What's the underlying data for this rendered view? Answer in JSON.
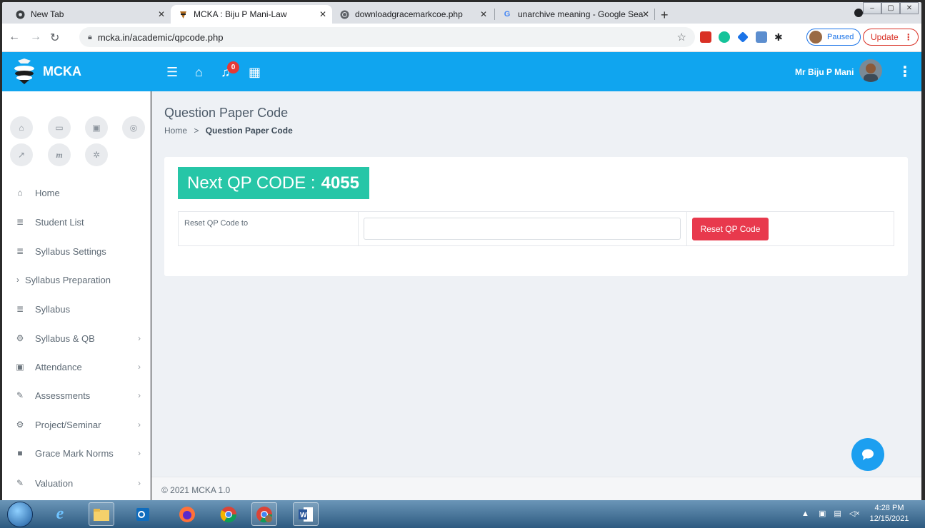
{
  "browser": {
    "tabs": [
      {
        "title": "New Tab",
        "icon": "chrome-newtab-icon"
      },
      {
        "title": "MCKA : Biju P Mani-Law",
        "icon": "mcka-logo-icon"
      },
      {
        "title": "downloadgracemarkcoe.php",
        "icon": "globe-icon"
      },
      {
        "title": "unarchive meaning - Google Sea",
        "icon": "google-icon"
      }
    ],
    "url": "mcka.in/academic/qpcode.php",
    "paused_label": "Paused",
    "update_label": "Update"
  },
  "app": {
    "brand": "MCKA",
    "notification_count": "0",
    "user_name": "Mr Biju P Mani",
    "header_color": "#10a5ef"
  },
  "sidebar": {
    "items": [
      {
        "label": "Home",
        "icon": "home-icon"
      },
      {
        "label": "Student List",
        "icon": "list-icon"
      },
      {
        "label": "Syllabus Settings",
        "icon": "list-icon"
      },
      {
        "label": "Syllabus Preparation",
        "icon": "chevron-right-icon"
      },
      {
        "label": "Syllabus",
        "icon": "list-icon"
      },
      {
        "label": "Syllabus & QB",
        "icon": "gears-icon"
      },
      {
        "label": "Attendance",
        "icon": "calendar-check-icon"
      },
      {
        "label": "Assessments",
        "icon": "pencil-icon"
      },
      {
        "label": "Project/Seminar",
        "icon": "gears-icon"
      },
      {
        "label": "Grace Mark Norms",
        "icon": "book-icon"
      },
      {
        "label": "Valuation",
        "icon": "pencil-icon"
      }
    ]
  },
  "page": {
    "title": "Question Paper Code",
    "breadcrumb_home": "Home",
    "breadcrumb_sep": ">",
    "breadcrumb_current": "Question Paper Code",
    "next_qp_label": "Next QP CODE :",
    "next_qp_value": "4055",
    "reset_label": "Reset QP Code to",
    "reset_input_value": "",
    "reset_button": "Reset QP Code",
    "accent_green": "#26c6a7",
    "danger_red": "#e8394d"
  },
  "footer": {
    "text": "© 2021 MCKA 1.0"
  },
  "taskbar": {
    "time": "4:28 PM",
    "date": "12/15/2021"
  }
}
